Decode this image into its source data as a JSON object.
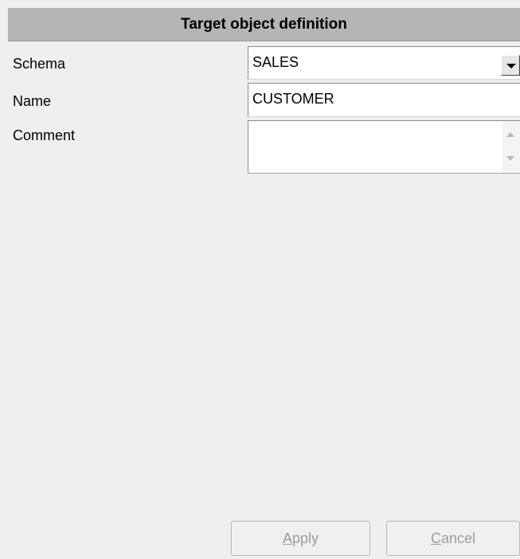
{
  "header": {
    "title": "Target object definition"
  },
  "form": {
    "schema": {
      "label": "Schema",
      "value": "SALES"
    },
    "name": {
      "label": "Name",
      "value": "CUSTOMER"
    },
    "comment": {
      "label": "Comment",
      "value": ""
    }
  },
  "buttons": {
    "apply": {
      "mnemonic": "A",
      "rest": "pply",
      "enabled": false
    },
    "cancel": {
      "mnemonic": "C",
      "rest": "ancel",
      "enabled": false
    }
  },
  "icons": {
    "dropdown": "chevron-down-icon",
    "scroll_up": "scroll-up-icon",
    "scroll_down": "scroll-down-icon"
  }
}
